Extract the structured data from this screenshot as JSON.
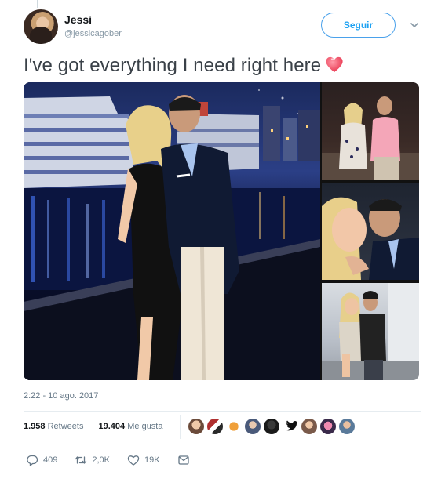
{
  "tweet": {
    "author_name": "Jessi",
    "author_handle": "@jessicagober",
    "follow_label": "Seguir",
    "text": "I've got everything I need right here",
    "timestamp": "2:22 - 10 ago. 2017",
    "stats": {
      "retweets_count": "1.958",
      "retweets_label": "Retweets",
      "likes_count": "19.404",
      "likes_label": "Me gusta"
    },
    "actions": {
      "replies": "409",
      "retweets": "2,0K",
      "likes": "19K"
    }
  },
  "colors": {
    "accent": "#1da1f2",
    "muted": "#657786",
    "heart": "#e0245e"
  },
  "icons": {
    "reply": "reply-icon",
    "retweet": "retweet-icon",
    "like": "like-icon",
    "message": "direct-message-icon",
    "more": "chevron-down-icon"
  }
}
